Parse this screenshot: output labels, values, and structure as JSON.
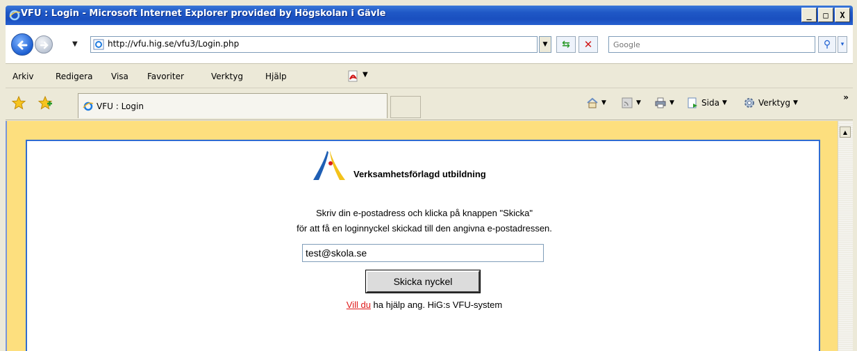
{
  "window": {
    "title": "VFU : Login - Microsoft Internet Explorer provided by Högskolan i Gävle",
    "buttons": [
      "_",
      "□",
      "X"
    ]
  },
  "address_bar": {
    "url": "http://vfu.hig.se/vfu3/Login.php",
    "search_placeholder": "Google"
  },
  "menu": {
    "items": [
      "Arkiv",
      "Redigera",
      "Visa",
      "Favoriter",
      "Verktyg",
      "Hjälp"
    ]
  },
  "tabs": {
    "active_title": "VFU : Login"
  },
  "command_bar": {
    "page_label": "Sida",
    "tools_label": "Verktyg",
    "overflow": "»"
  },
  "page": {
    "logo_text": "Verksamhetsförlagd utbildning",
    "instruction_line1": "Skriv din e-postadress och klicka på knappen \"Skicka\"",
    "instruction_line2": "för att få en loginnyckel skickad till den angivna e-postadressen.",
    "email_value": "test@skola.se",
    "submit_label": "Skicka nyckel",
    "help_link": "Vill du",
    "help_rest": " ha hjälp ang. HiG:s VFU-system"
  },
  "colors": {
    "page_background": "#fddf7e",
    "panel_border": "#2f6cd1",
    "link": "#e01818",
    "titlebar": "#1f58c6"
  }
}
